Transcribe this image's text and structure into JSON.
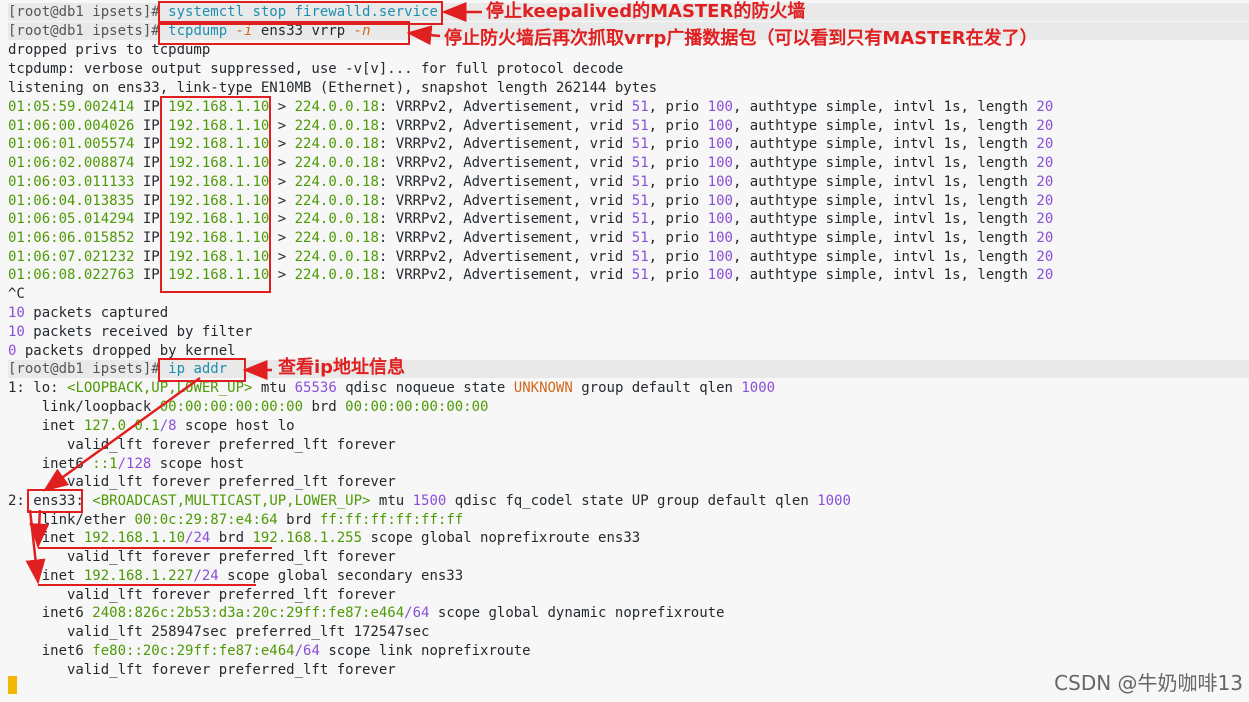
{
  "prompt": "[root@db1 ipsets]#",
  "commands": {
    "stop_firewall": "systemctl stop firewalld.service",
    "tcpdump_cmd": "tcpdump",
    "tcpdump_flag_i": "-i",
    "tcpdump_iface": "ens33 vrrp",
    "tcpdump_flag_n": "-n",
    "ip_addr": "ip addr"
  },
  "annotations": {
    "stop_keepalived_master_firewall": "停止keepalived的MASTER的防火墙",
    "capture_after_firewall_stop": "停止防火墙后再次抓取vrrp广播数据包（可以看到只有MASTER在发了）",
    "view_ip_info": "查看ip地址信息"
  },
  "tcpdump_header": {
    "line1": "dropped privs to tcpdump",
    "line2": "tcpdump: verbose output suppressed, use -v[v]... for full protocol decode",
    "line3": "listening on ens33, link-type EN10MB (Ethernet), snapshot length 262144 bytes"
  },
  "packets": [
    {
      "time": "01:05:59.002414",
      "src": "192.168.1.10",
      "dst": "224.0.0.18",
      "vrid": "51",
      "prio": "100",
      "intvl": "1s",
      "length": "20"
    },
    {
      "time": "01:06:00.004026",
      "src": "192.168.1.10",
      "dst": "224.0.0.18",
      "vrid": "51",
      "prio": "100",
      "intvl": "1s",
      "length": "20"
    },
    {
      "time": "01:06:01.005574",
      "src": "192.168.1.10",
      "dst": "224.0.0.18",
      "vrid": "51",
      "prio": "100",
      "intvl": "1s",
      "length": "20"
    },
    {
      "time": "01:06:02.008874",
      "src": "192.168.1.10",
      "dst": "224.0.0.18",
      "vrid": "51",
      "prio": "100",
      "intvl": "1s",
      "length": "20"
    },
    {
      "time": "01:06:03.011133",
      "src": "192.168.1.10",
      "dst": "224.0.0.18",
      "vrid": "51",
      "prio": "100",
      "intvl": "1s",
      "length": "20"
    },
    {
      "time": "01:06:04.013835",
      "src": "192.168.1.10",
      "dst": "224.0.0.18",
      "vrid": "51",
      "prio": "100",
      "intvl": "1s",
      "length": "20"
    },
    {
      "time": "01:06:05.014294",
      "src": "192.168.1.10",
      "dst": "224.0.0.18",
      "vrid": "51",
      "prio": "100",
      "intvl": "1s",
      "length": "20"
    },
    {
      "time": "01:06:06.015852",
      "src": "192.168.1.10",
      "dst": "224.0.0.18",
      "vrid": "51",
      "prio": "100",
      "intvl": "1s",
      "length": "20"
    },
    {
      "time": "01:06:07.021232",
      "src": "192.168.1.10",
      "dst": "224.0.0.18",
      "vrid": "51",
      "prio": "100",
      "intvl": "1s",
      "length": "20"
    },
    {
      "time": "01:06:08.022763",
      "src": "192.168.1.10",
      "dst": "224.0.0.18",
      "vrid": "51",
      "prio": "100",
      "intvl": "1s",
      "length": "20"
    }
  ],
  "summary": {
    "ctrl_c": "^C",
    "captured_count": "10",
    "captured_label": " packets captured",
    "received_count": "10",
    "received_label": " packets received by filter",
    "dropped_count": "0",
    "dropped_label": " packets dropped by kernel"
  },
  "ip_addr": {
    "lo_index": "1: lo: ",
    "lo_flags": "<LOOPBACK,UP,LOWER_UP>",
    "lo_mtu_label": " mtu ",
    "lo_mtu": "65536",
    "lo_rest1": " qdisc noqueue state ",
    "lo_state": "UNKNOWN",
    "lo_rest2": " group default qlen ",
    "lo_qlen": "1000",
    "lo_link_label": "    link/loopback ",
    "lo_mac": "00:00:00:00:00:00",
    "lo_brd_label": " brd ",
    "lo_brd": "00:00:00:00:00:00",
    "lo_inet_label": "    inet ",
    "lo_inet": "127.0.0.1",
    "lo_inet_prefix": "/8",
    "lo_inet_rest": " scope host lo",
    "valid_lft_forever": "       valid_lft forever preferred_lft forever",
    "lo_inet6_label": "    inet6 ",
    "lo_inet6": "::1",
    "lo_inet6_prefix": "/128",
    "lo_inet6_rest": " scope host",
    "ens_index": "2: ",
    "ens_name": "ens33",
    "ens_colon": ": ",
    "ens_flags": "<BROADCAST,MULTICAST,UP,LOWER_UP>",
    "ens_mtu_label": " mtu ",
    "ens_mtu": "1500",
    "ens_rest": " qdisc fq_codel state UP group default qlen ",
    "ens_qlen": "1000",
    "ens_link_label": "    link/ether ",
    "ens_mac": "00:0c:29:87:e4:64",
    "ens_brd_label": " brd ",
    "ens_brd": "ff:ff:ff:ff:ff:ff",
    "ens_inet_label": "    inet ",
    "ens_inet": "192.168.1.10",
    "ens_inet_prefix": "/24",
    "ens_inet_brd_label": " brd ",
    "ens_inet_brd": "192.168.1.255",
    "ens_inet_rest": " scope global noprefixroute ens33",
    "ens_vip_label": "    inet ",
    "ens_vip": "192.168.1.227",
    "ens_vip_prefix": "/24",
    "ens_vip_rest": " scope global secondary ens33",
    "ens_inet6_label": "    inet6 ",
    "ens_inet6": "2408:826c:2b53:d3a:20c:29ff:fe87:e464",
    "ens_inet6_prefix": "/64",
    "ens_inet6_rest": " scope global dynamic noprefixroute",
    "ens_inet6_lft": "       valid_lft 258947sec preferred_lft 172547sec",
    "ens_link6_label": "    inet6 ",
    "ens_link6": "fe80::20c:29ff:fe87:e464",
    "ens_link6_prefix": "/64",
    "ens_link6_rest": " scope link noprefixroute"
  },
  "watermark": "CSDN @牛奶咖啡13",
  "colors": {
    "annotation_red": "#e02020",
    "ip_green": "#4e9a06",
    "number_purple": "#8a4fd8",
    "command_cyan": "#1f8fb0",
    "state_orange": "#d2691e",
    "cursor_yellow": "#f2b705"
  }
}
